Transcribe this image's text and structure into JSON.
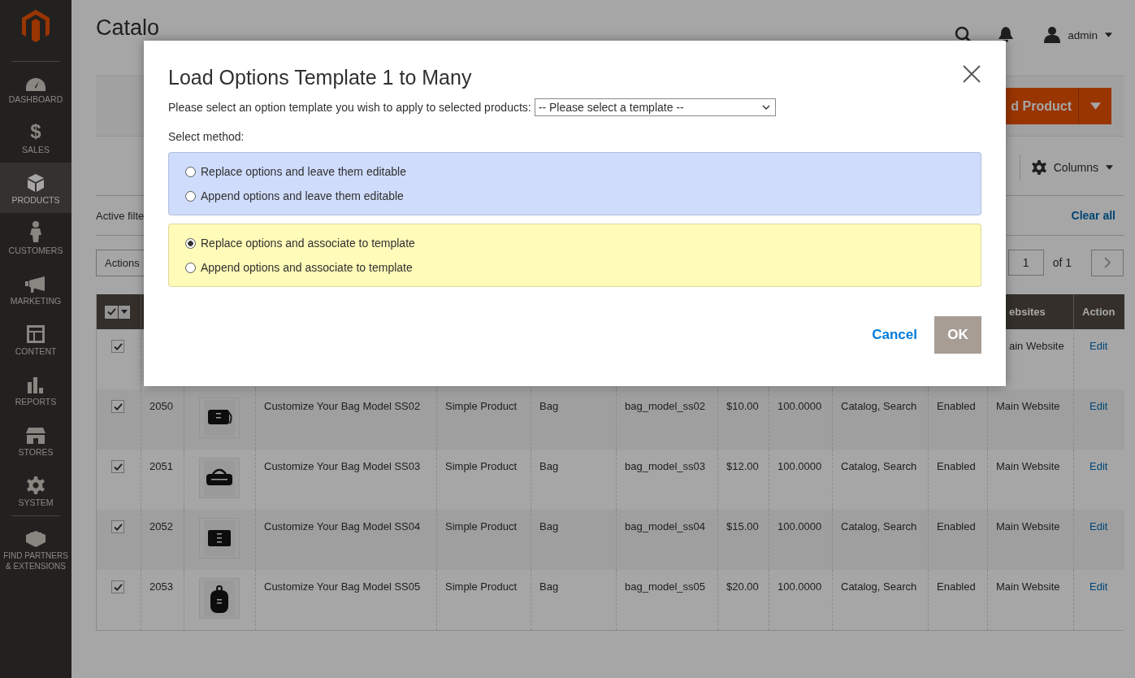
{
  "sidebar": {
    "items": [
      {
        "label": "DASHBOARD",
        "selected": false
      },
      {
        "label": "SALES",
        "glyph": "$",
        "selected": false
      },
      {
        "label": "PRODUCTS",
        "selected": true
      },
      {
        "label": "CUSTOMERS",
        "selected": false
      },
      {
        "label": "MARKETING",
        "selected": false
      },
      {
        "label": "CONTENT",
        "selected": false
      },
      {
        "label": "REPORTS",
        "selected": false
      },
      {
        "label": "STORES",
        "selected": false
      },
      {
        "label": "SYSTEM",
        "selected": false
      },
      {
        "label": "FIND PARTNERS & EXTENSIONS",
        "selected": false
      }
    ]
  },
  "page": {
    "title": "Catalo",
    "user": "admin",
    "add_button": "d Product"
  },
  "toolbar": {
    "columns": "Columns",
    "active_filters": "Active filte",
    "clear_all": "Clear all",
    "actions": "Actions",
    "page": "1",
    "page_total": "of 1"
  },
  "table": {
    "select_all": {
      "checked": true
    },
    "columns": [
      "ebsites",
      "Action"
    ],
    "rows": [
      {
        "kind": "partial",
        "checked": true,
        "websites": "ain Website",
        "action": "Edit"
      },
      {
        "kind": "full",
        "checked": true,
        "id": "2050",
        "name": "Customize Your Bag Model SS02",
        "type": "Simple Product",
        "attribute_set": "Bag",
        "sku": "bag_model_ss02",
        "price": "$10.00",
        "quantity": "100.0000",
        "visibility": "Catalog, Search",
        "status": "Enabled",
        "websites": "Main Website",
        "action": "Edit"
      },
      {
        "kind": "full",
        "checked": true,
        "id": "2051",
        "name": "Customize Your Bag Model SS03",
        "type": "Simple Product",
        "attribute_set": "Bag",
        "sku": "bag_model_ss03",
        "price": "$12.00",
        "quantity": "100.0000",
        "visibility": "Catalog, Search",
        "status": "Enabled",
        "websites": "Main Website",
        "action": "Edit"
      },
      {
        "kind": "full",
        "checked": true,
        "id": "2052",
        "name": "Customize Your Bag Model SS04",
        "type": "Simple Product",
        "attribute_set": "Bag",
        "sku": "bag_model_ss04",
        "price": "$15.00",
        "quantity": "100.0000",
        "visibility": "Catalog, Search",
        "status": "Enabled",
        "websites": "Main Website",
        "action": "Edit"
      },
      {
        "kind": "full",
        "checked": true,
        "id": "2053",
        "name": "Customize Your Bag Model SS05",
        "type": "Simple Product",
        "attribute_set": "Bag",
        "sku": "bag_model_ss05",
        "price": "$20.00",
        "quantity": "100.0000",
        "visibility": "Catalog, Search",
        "status": "Enabled",
        "websites": "Main Website",
        "action": "Edit"
      }
    ]
  },
  "modal": {
    "title": "Load Options Template 1 to Many",
    "prompt": "Please select an option template you wish to apply to selected products:",
    "template_select": "-- Please select a template --",
    "method_label": "Select method:",
    "groups": [
      {
        "color": "#cfdcfc",
        "options": [
          {
            "label": "Replace options and leave them editable",
            "selected": false
          },
          {
            "label": "Append options and leave them editable",
            "selected": false
          }
        ]
      },
      {
        "color": "#fffbb8",
        "options": [
          {
            "label": "Replace options and associate to template",
            "selected": true
          },
          {
            "label": "Append options and associate to template",
            "selected": false
          }
        ]
      }
    ],
    "cancel": "Cancel",
    "ok": "OK"
  }
}
